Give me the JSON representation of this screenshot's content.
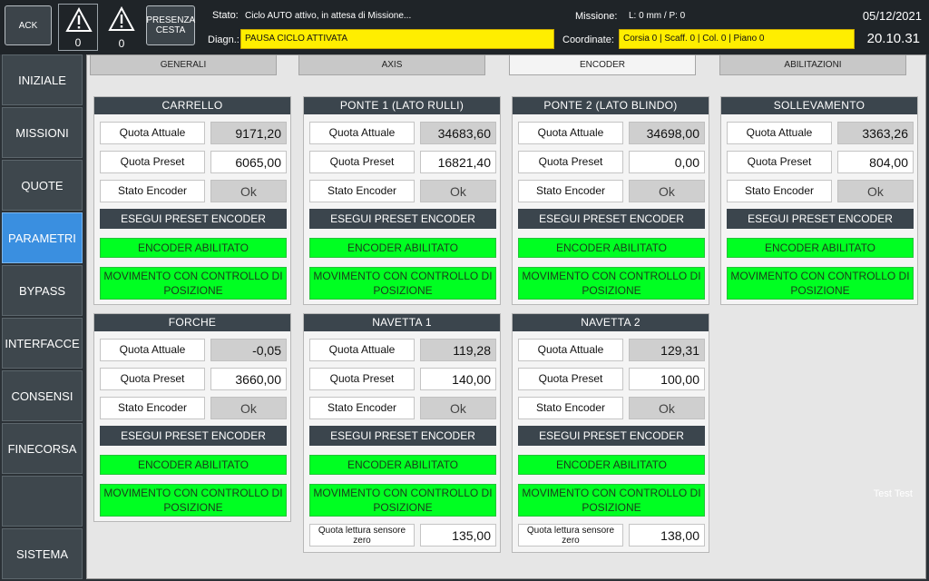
{
  "header": {
    "ack_label": "ACK",
    "alarm1_count": "0",
    "alarm2_count": "0",
    "presenza_cesta_label": "PRESENZA CESTA",
    "stato_label": "Stato:",
    "stato_value": "Ciclo AUTO attivo, in attesa di Missione...",
    "diagn_label": "Diagn.:",
    "diagn_value": "PAUSA CICLO ATTIVATA",
    "missione_label": "Missione:",
    "missione_value": "L: 0 mm / P: 0",
    "coordinate_label": "Coordinate:",
    "coordinate_value": "Corsia 0 | Scaff. 0 | Col. 0 | Piano 0",
    "date": "05/12/2021",
    "time": "20.10.31",
    "colors": {
      "warning_yellow": "#ffee00",
      "active_blue": "#3a8fe0",
      "enabled_green": "#00ff22"
    }
  },
  "sidebar": {
    "items": [
      {
        "label": "INIZIALE"
      },
      {
        "label": "MISSIONI"
      },
      {
        "label": "QUOTE"
      },
      {
        "label": "PARAMETRI",
        "active": true
      },
      {
        "label": "BYPASS"
      },
      {
        "label": "INTERFACCE"
      },
      {
        "label": "CONSENSI"
      },
      {
        "label": "FINECORSA"
      },
      {
        "label": ""
      },
      {
        "label": "SISTEMA"
      }
    ]
  },
  "tabs": [
    {
      "label": "GENERALI"
    },
    {
      "label": "AXIS"
    },
    {
      "label": "ENCODER",
      "active": true
    },
    {
      "label": "ABILITAZIONI"
    }
  ],
  "common": {
    "quota_attuale": "Quota Attuale",
    "quota_preset": "Quota Preset",
    "stato_encoder": "Stato Encoder",
    "esegui_preset": "ESEGUI PRESET ENCODER",
    "encoder_abilitato": "ENCODER ABILITATO",
    "movimento_controllo": "MOVIMENTO CON CONTROLLO DI POSIZIONE",
    "quota_lettura": "Quota lettura sensore zero"
  },
  "panels": {
    "carrello": {
      "title": "CARRELLO",
      "quota_attuale": "9171,20",
      "quota_preset": "6065,00",
      "stato": "Ok"
    },
    "ponte1": {
      "title": "PONTE 1 (LATO RULLI)",
      "quota_attuale": "34683,60",
      "quota_preset": "16821,40",
      "stato": "Ok"
    },
    "ponte2": {
      "title": "PONTE 2 (LATO BLINDO)",
      "quota_attuale": "34698,00",
      "quota_preset": "0,00",
      "stato": "Ok"
    },
    "sollevamento": {
      "title": "SOLLEVAMENTO",
      "quota_attuale": "3363,26",
      "quota_preset": "804,00",
      "stato": "Ok"
    },
    "forche": {
      "title": "FORCHE",
      "quota_attuale": "-0,05",
      "quota_preset": "3660,00",
      "stato": "Ok"
    },
    "navetta1": {
      "title": "NAVETTA 1",
      "quota_attuale": "119,28",
      "quota_preset": "140,00",
      "stato": "Ok",
      "quota_lettura": "135,00"
    },
    "navetta2": {
      "title": "NAVETTA 2",
      "quota_attuale": "129,31",
      "quota_preset": "100,00",
      "stato": "Ok",
      "quota_lettura": "138,00"
    }
  },
  "watermark": "Test Test"
}
